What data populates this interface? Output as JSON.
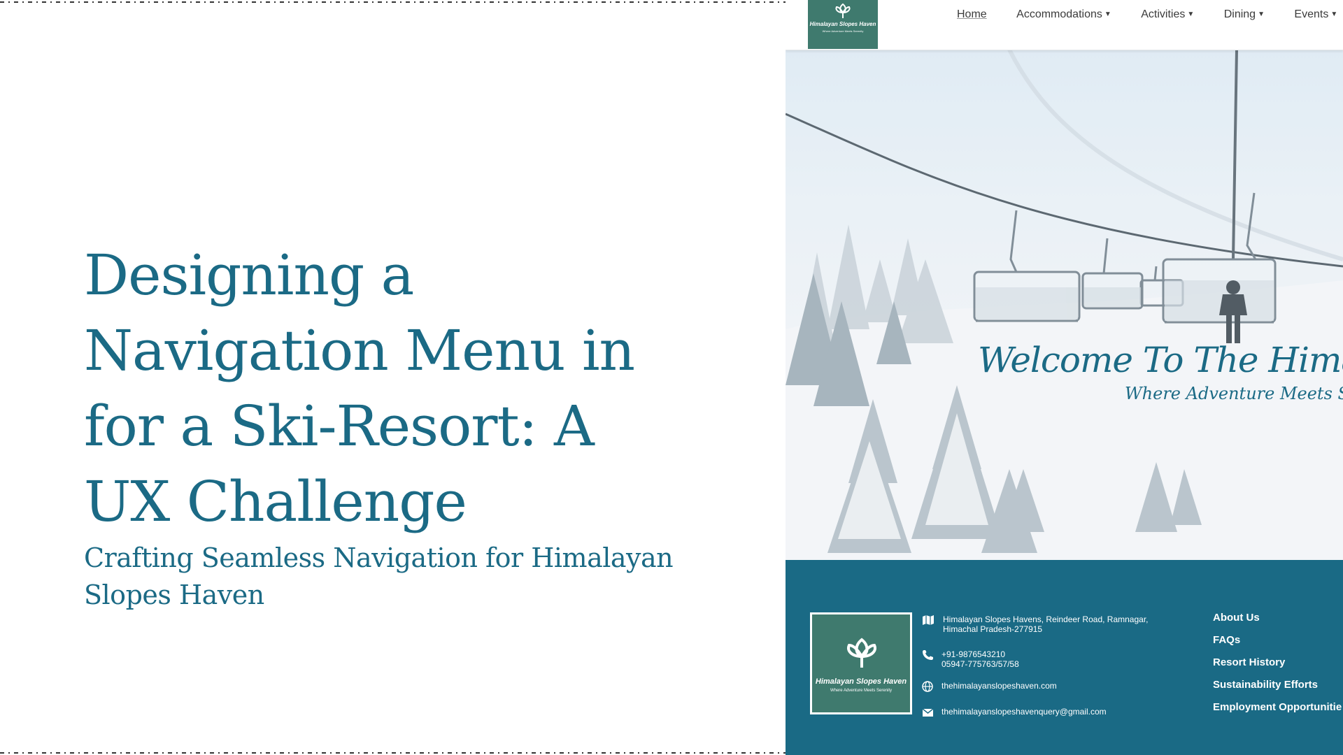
{
  "slide": {
    "title": "Designing a Navigation Menu in for a Ski-Resort: A UX Challenge",
    "subtitle": "Crafting Seamless Navigation for Himalayan Slopes Haven"
  },
  "site": {
    "brand": {
      "name": "Himalayan Slopes Haven",
      "tagline": "Where Adventure Meets Serenity"
    },
    "nav": [
      {
        "label": "Home",
        "dropdown": false,
        "active": true
      },
      {
        "label": "Accommodations",
        "dropdown": true
      },
      {
        "label": "Activities",
        "dropdown": true
      },
      {
        "label": "Dining",
        "dropdown": true
      },
      {
        "label": "Events",
        "dropdown": true
      }
    ],
    "hero": {
      "welcome": "Welcome To The Himalyan Sl",
      "tagline": "Where Adventure Meets Serenity"
    },
    "footer": {
      "address_line1": "Himalayan Slopes Havens, Reindeer Road, Ramnagar,",
      "address_line2": "Himachal Pradesh-277915",
      "phone1": "+91-9876543210",
      "phone2": "05947-775763/57/58",
      "website": "thehimalayanslopeshaven.com",
      "email": "thehimalayanslopeshavenquery@gmail.com",
      "links": [
        "About Us",
        "FAQs",
        "Resort History",
        "Sustainability Efforts",
        "Employment Opportunitie"
      ]
    }
  },
  "colors": {
    "accent": "#1b6a85",
    "footer_bg": "#1a6a85",
    "logo_bg": "#3f7a6e"
  },
  "icons": [
    "map-icon",
    "phone-icon",
    "globe-icon",
    "mail-icon",
    "caret-down-icon",
    "lotus-logo-icon"
  ]
}
